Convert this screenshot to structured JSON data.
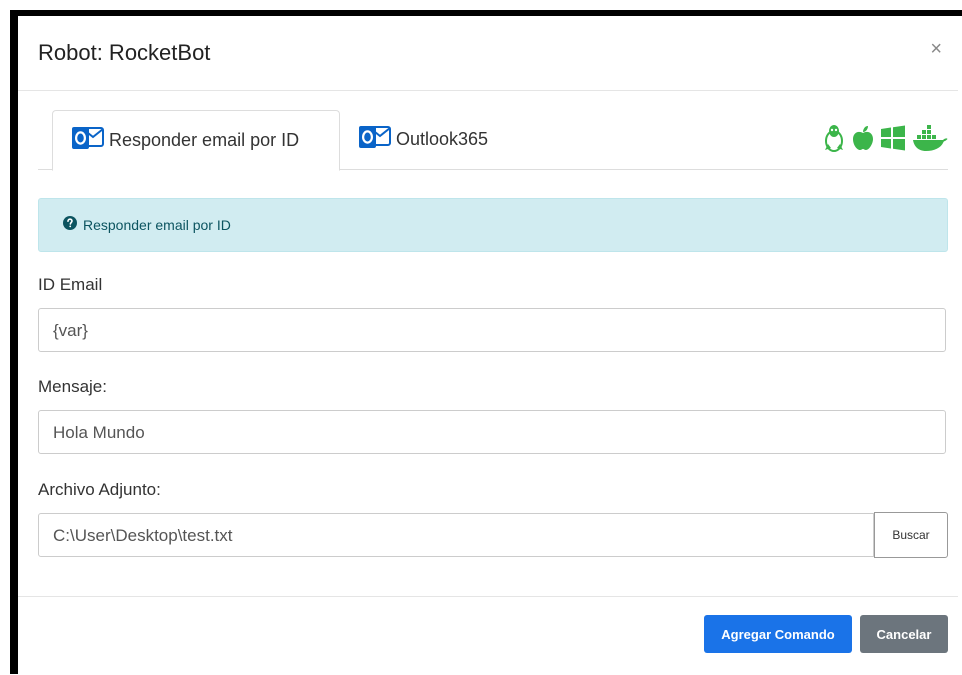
{
  "modal": {
    "title": "Robot: RocketBot",
    "close_glyph": "×"
  },
  "tabs": [
    {
      "label": "Responder email por ID",
      "icon": "outlook-icon",
      "active": true
    },
    {
      "label": "Outlook365",
      "icon": "outlook-icon",
      "active": false
    }
  ],
  "os_icons": [
    "linux-icon",
    "apple-icon",
    "windows-icon",
    "docker-icon"
  ],
  "info": {
    "icon": "question-circle-icon",
    "text": "Responder email por ID"
  },
  "form": {
    "id_email": {
      "label": "ID Email",
      "value": "{var}"
    },
    "mensaje": {
      "label": "Mensaje:",
      "value": "Hola Mundo"
    },
    "archivo": {
      "label": "Archivo Adjunto:",
      "value": "C:\\User\\Desktop\\test.txt",
      "button": "Buscar"
    }
  },
  "footer": {
    "primary": "Agregar Comando",
    "secondary": "Cancelar"
  },
  "colors": {
    "os_icon_green": "#3cb54a",
    "outlook_blue": "#0a64c8",
    "primary_button": "#1a73e8",
    "secondary_button": "#6c757d",
    "info_background": "#d1ecf1"
  }
}
